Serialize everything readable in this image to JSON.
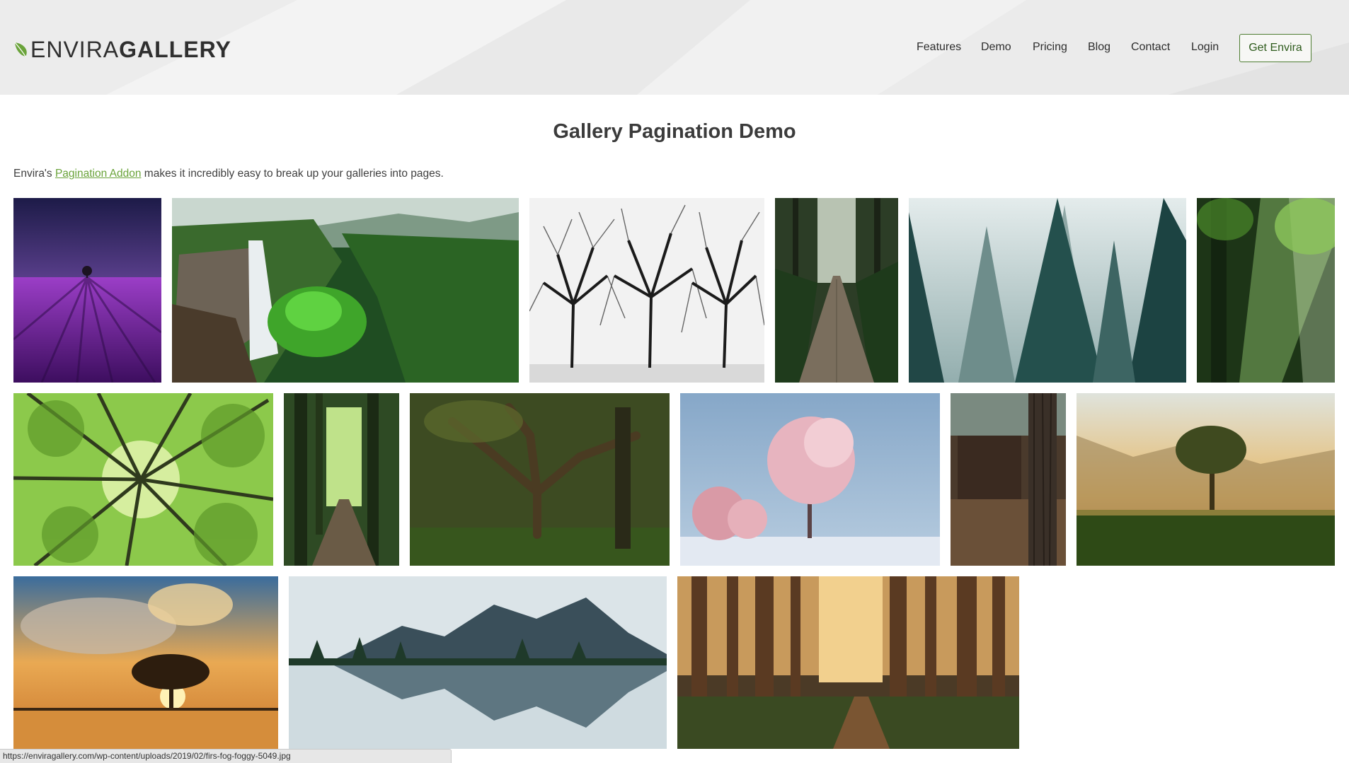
{
  "brand": {
    "part1": "ENVIRA",
    "part2": "GALLERY",
    "leaf_color": "#6aa33a"
  },
  "nav": {
    "items": [
      "Features",
      "Demo",
      "Pricing",
      "Blog",
      "Contact",
      "Login"
    ],
    "cta": "Get Envira"
  },
  "content": {
    "title": "Gallery Pagination Demo",
    "intro_before": "Envira's ",
    "intro_link": "Pagination Addon",
    "intro_after": " makes it incredibly easy to break up your galleries into pages."
  },
  "gallery": {
    "images": [
      "lavender-field-night",
      "waterfall-forest",
      "bare-trees-bw",
      "wooden-forest-path",
      "foggy-pine-forest",
      "sunbeams-forest",
      "tree-canopy-looking-up",
      "forest-trail",
      "old-oak-tree",
      "pink-frosted-tree",
      "tree-trunk-cabin",
      "tree-at-sunrise",
      "sunset-tree-reflection",
      "mountain-lake-reflection",
      "sunlit-redwood-forest"
    ]
  },
  "status_bar": {
    "url": "https://enviragallery.com/wp-content/uploads/2019/02/firs-fog-foggy-5049.jpg"
  },
  "colors": {
    "accent": "#6aa33a",
    "cta_border": "#4e7d32",
    "header_bg": "#efefef"
  }
}
